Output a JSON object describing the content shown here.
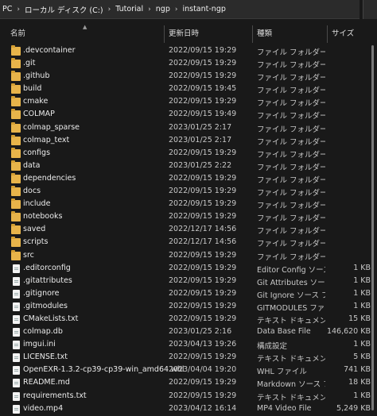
{
  "breadcrumb": [
    "PC",
    "ローカル ディスク (C:)",
    "Tutorial",
    "ngp",
    "instant-ngp"
  ],
  "columns": {
    "name": "名前",
    "date": "更新日時",
    "type": "種類",
    "size": "サイズ"
  },
  "files": [
    {
      "name": ".devcontainer",
      "date": "2022/09/15 19:29",
      "type": "ファイル フォルダー",
      "size": "",
      "kind": "folder"
    },
    {
      "name": ".git",
      "date": "2022/09/15 19:29",
      "type": "ファイル フォルダー",
      "size": "",
      "kind": "folder"
    },
    {
      "name": ".github",
      "date": "2022/09/15 19:29",
      "type": "ファイル フォルダー",
      "size": "",
      "kind": "folder"
    },
    {
      "name": "build",
      "date": "2022/09/15 19:45",
      "type": "ファイル フォルダー",
      "size": "",
      "kind": "folder"
    },
    {
      "name": "cmake",
      "date": "2022/09/15 19:29",
      "type": "ファイル フォルダー",
      "size": "",
      "kind": "folder"
    },
    {
      "name": "COLMAP",
      "date": "2022/09/15 19:49",
      "type": "ファイル フォルダー",
      "size": "",
      "kind": "folder"
    },
    {
      "name": "colmap_sparse",
      "date": "2023/01/25 2:17",
      "type": "ファイル フォルダー",
      "size": "",
      "kind": "folder"
    },
    {
      "name": "colmap_text",
      "date": "2023/01/25 2:17",
      "type": "ファイル フォルダー",
      "size": "",
      "kind": "folder"
    },
    {
      "name": "configs",
      "date": "2022/09/15 19:29",
      "type": "ファイル フォルダー",
      "size": "",
      "kind": "folder"
    },
    {
      "name": "data",
      "date": "2023/01/25 2:22",
      "type": "ファイル フォルダー",
      "size": "",
      "kind": "folder"
    },
    {
      "name": "dependencies",
      "date": "2022/09/15 19:29",
      "type": "ファイル フォルダー",
      "size": "",
      "kind": "folder"
    },
    {
      "name": "docs",
      "date": "2022/09/15 19:29",
      "type": "ファイル フォルダー",
      "size": "",
      "kind": "folder"
    },
    {
      "name": "include",
      "date": "2022/09/15 19:29",
      "type": "ファイル フォルダー",
      "size": "",
      "kind": "folder"
    },
    {
      "name": "notebooks",
      "date": "2022/09/15 19:29",
      "type": "ファイル フォルダー",
      "size": "",
      "kind": "folder"
    },
    {
      "name": "saved",
      "date": "2022/12/17 14:56",
      "type": "ファイル フォルダー",
      "size": "",
      "kind": "folder"
    },
    {
      "name": "scripts",
      "date": "2022/12/17 14:56",
      "type": "ファイル フォルダー",
      "size": "",
      "kind": "folder"
    },
    {
      "name": "src",
      "date": "2022/09/15 19:29",
      "type": "ファイル フォルダー",
      "size": "",
      "kind": "folder"
    },
    {
      "name": ".editorconfig",
      "date": "2022/09/15 19:29",
      "type": "Editor Config ソース...",
      "size": "1 KB",
      "kind": "file"
    },
    {
      "name": ".gitattributes",
      "date": "2022/09/15 19:29",
      "type": "Git Attributes ソー...",
      "size": "1 KB",
      "kind": "file"
    },
    {
      "name": ".gitignore",
      "date": "2022/09/15 19:29",
      "type": "Git Ignore ソース フ...",
      "size": "1 KB",
      "kind": "file"
    },
    {
      "name": ".gitmodules",
      "date": "2022/09/15 19:29",
      "type": "GITMODULES ファイル",
      "size": "1 KB",
      "kind": "file"
    },
    {
      "name": "CMakeLists.txt",
      "date": "2022/09/15 19:29",
      "type": "テキスト ドキュメント",
      "size": "15 KB",
      "kind": "file"
    },
    {
      "name": "colmap.db",
      "date": "2023/01/25 2:16",
      "type": "Data Base File",
      "size": "146,620 KB",
      "kind": "file"
    },
    {
      "name": "imgui.ini",
      "date": "2023/04/13 19:26",
      "type": "構成設定",
      "size": "1 KB",
      "kind": "file"
    },
    {
      "name": "LICENSE.txt",
      "date": "2022/09/15 19:29",
      "type": "テキスト ドキュメント",
      "size": "5 KB",
      "kind": "file"
    },
    {
      "name": "OpenEXR-1.3.2-cp39-cp39-win_amd64.whl",
      "date": "2023/04/04 19:20",
      "type": "WHL ファイル",
      "size": "741 KB",
      "kind": "file"
    },
    {
      "name": "README.md",
      "date": "2022/09/15 19:29",
      "type": "Markdown ソース フ...",
      "size": "18 KB",
      "kind": "file"
    },
    {
      "name": "requirements.txt",
      "date": "2022/09/15 19:29",
      "type": "テキスト ドキュメント",
      "size": "1 KB",
      "kind": "file"
    },
    {
      "name": "video.mp4",
      "date": "2023/04/12 16:14",
      "type": "MP4 Video File",
      "size": "5,249 KB",
      "kind": "file"
    }
  ]
}
